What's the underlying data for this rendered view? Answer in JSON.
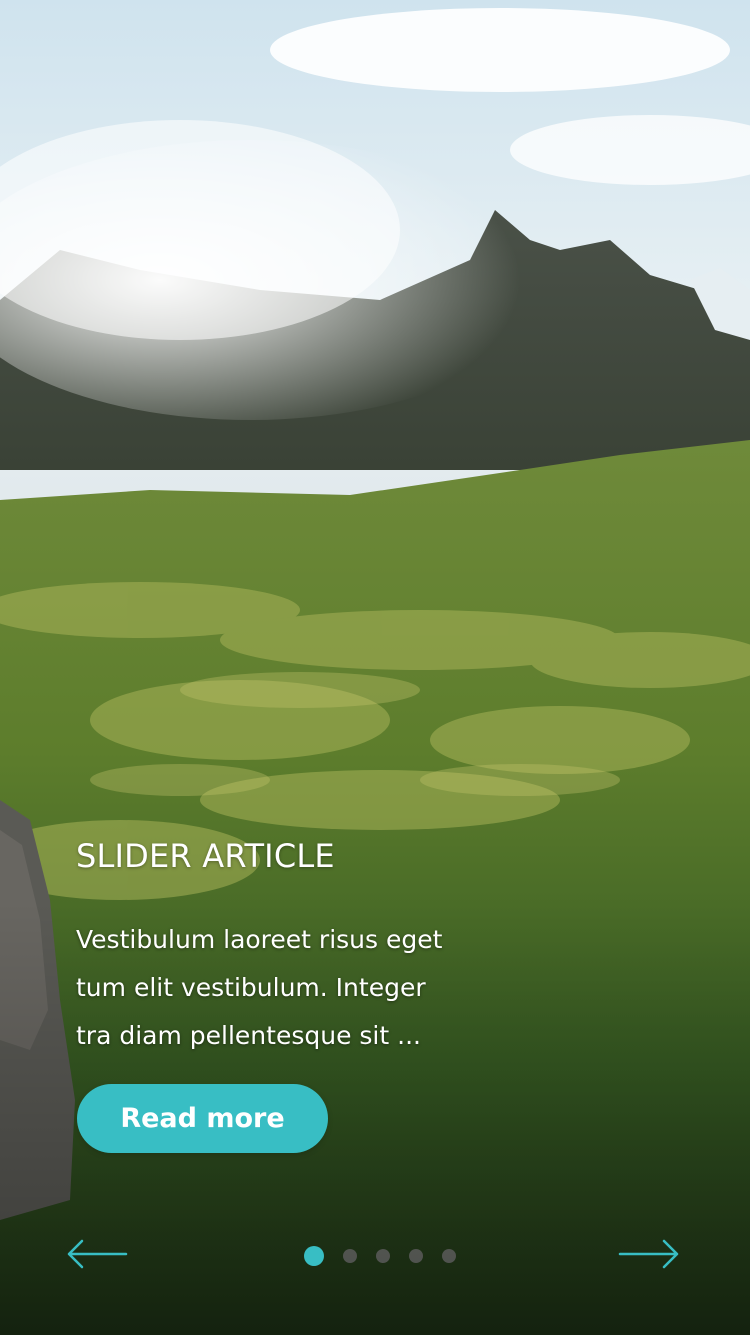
{
  "slider": {
    "title": "SLIDER ARTICLE",
    "excerpt_lines": [
      "Vestibulum laoreet risus eget",
      "tum elit vestibulum. Integer",
      "tra diam pellentesque sit ..."
    ],
    "read_more_label": "Read more",
    "total_slides": 5,
    "active_slide": 1,
    "accent_color": "#38bec4",
    "background_image": "mountain-meadow-landscape"
  },
  "controls": {
    "prev_icon": "arrow-left-icon",
    "next_icon": "arrow-right-icon"
  }
}
